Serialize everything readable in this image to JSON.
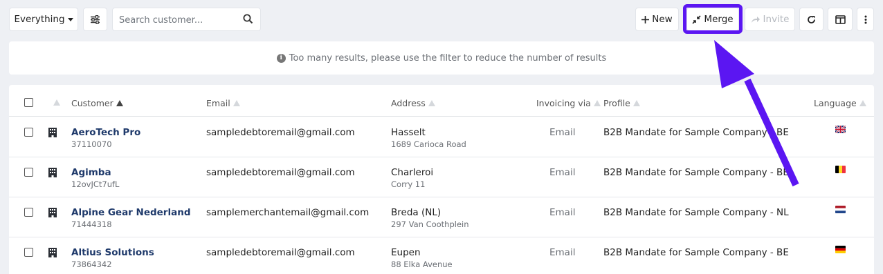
{
  "toolbar": {
    "filter_label": "Everything",
    "search_placeholder": "Search customer...",
    "new_label": "New",
    "merge_label": "Merge",
    "invite_label": "Invite"
  },
  "notice": {
    "text": "Too many results, please use the filter to reduce the number of results"
  },
  "table": {
    "headers": {
      "customer": "Customer",
      "email": "Email",
      "address": "Address",
      "invoicing": "Invoicing via",
      "profile": "Profile",
      "language": "Language"
    },
    "rows": [
      {
        "name": "AeroTech Pro",
        "id": "37110070",
        "email": "sampledebtoremail@gmail.com",
        "city": "Hasselt",
        "street": "1689 Carioca Road",
        "via": "Email",
        "profile": "B2B Mandate for Sample Company - BE",
        "flag": "uk"
      },
      {
        "name": "Agimba",
        "id": "12ovJCt7ufL",
        "email": "sampledebtoremail@gmail.com",
        "city": "Charleroi",
        "street": "Corry 11",
        "via": "Email",
        "profile": "B2B Mandate for Sample Company - BE",
        "flag": "be"
      },
      {
        "name": "Alpine Gear Nederland",
        "id": "71444318",
        "email": "samplemerchantemail@gmail.com",
        "city": "Breda (NL)",
        "street": "297 Van Coothplein",
        "via": "Email",
        "profile": "B2B Mandate for Sample Company - NL",
        "flag": "nl"
      },
      {
        "name": "Altius Solutions",
        "id": "73864342",
        "email": "sampledebtoremail@gmail.com",
        "city": "Eupen",
        "street": "88 Elka Avenue",
        "via": "Email",
        "profile": "B2B Mandate for Sample Company - BE",
        "flag": "de"
      }
    ]
  },
  "colors": {
    "highlight": "#5b16f2",
    "link": "#1f3a6b",
    "background": "#eef0f4"
  }
}
